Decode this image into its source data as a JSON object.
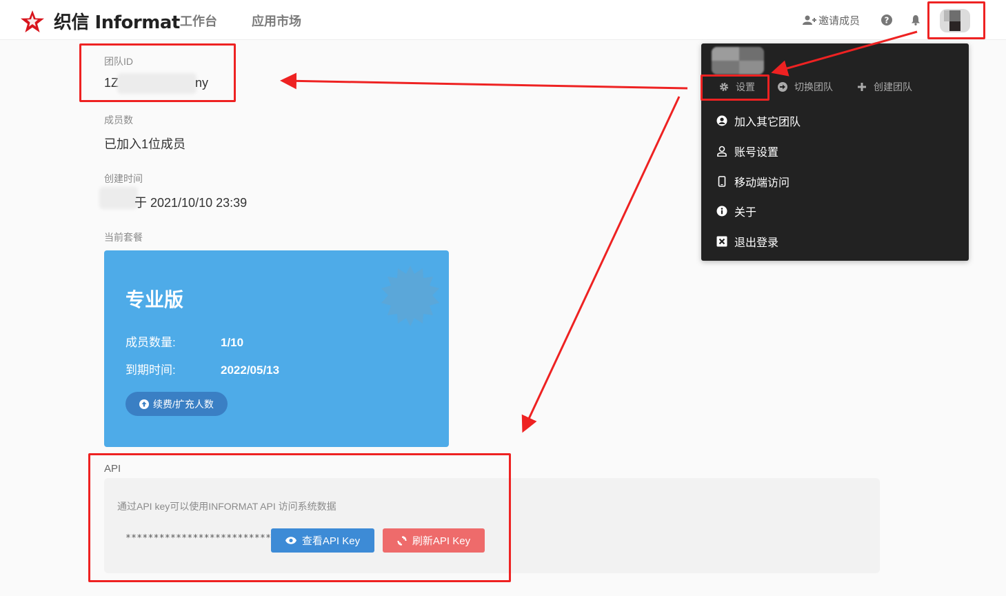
{
  "header": {
    "logo_text": "织信 Informat",
    "nav": [
      "工作台",
      "应用市场"
    ],
    "invite_label": "邀请成员",
    "icons": [
      "user-plus-icon",
      "help-icon",
      "bell-icon"
    ]
  },
  "team": {
    "id_label": "团队ID",
    "id_prefix": "1Z",
    "id_suffix": "ny",
    "members_label": "成员数",
    "members_value": "已加入1位成员",
    "created_label": "创建时间",
    "created_suffix": "于 2021/10/10 23:39",
    "plan_label": "当前套餐"
  },
  "plan": {
    "name": "专业版",
    "members_key": "成员数量:",
    "members_value": "1/10",
    "expire_key": "到期时间:",
    "expire_value": "2022/05/13",
    "renew_label": "续费/扩充人数",
    "accent": "#4eabe8"
  },
  "api": {
    "label": "API",
    "description": "通过API key可以使用INFORMAT API 访问系统数据",
    "masked_key": "**********************************",
    "view_label": "查看API Key",
    "refresh_label": "刷新API Key",
    "view_color": "#3d8bd6",
    "refresh_color": "#ee6b6b"
  },
  "menu": {
    "sub": [
      {
        "label": "设置",
        "icon": "gear-icon"
      },
      {
        "label": "切换团队",
        "icon": "arrow-circle-right-icon"
      },
      {
        "label": "创建团队",
        "icon": "plus-icon"
      }
    ],
    "items": [
      {
        "label": "加入其它团队",
        "icon": "user-circle-icon"
      },
      {
        "label": "账号设置",
        "icon": "user-icon"
      },
      {
        "label": "移动端访问",
        "icon": "mobile-icon"
      },
      {
        "label": "关于",
        "icon": "info-icon"
      },
      {
        "label": "退出登录",
        "icon": "close-square-icon"
      }
    ]
  },
  "annotation_color": "#ee2222"
}
